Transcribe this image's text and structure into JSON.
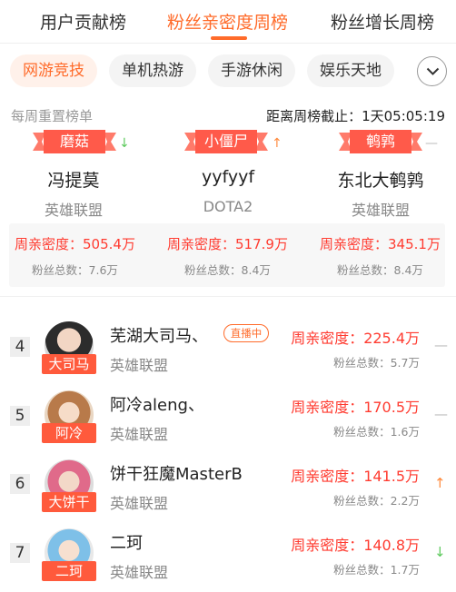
{
  "tabs": [
    {
      "label": "用户贡献榜"
    },
    {
      "label": "粉丝亲密度周榜"
    },
    {
      "label": "粉丝增长周榜"
    }
  ],
  "categories": [
    {
      "label": "网游竞技"
    },
    {
      "label": "单机热游"
    },
    {
      "label": "手游休闲"
    },
    {
      "label": "娱乐天地"
    }
  ],
  "meta": {
    "reset_note": "每周重置榜单",
    "countdown": "距离周榜截止：1天05:05:19"
  },
  "top3": [
    {
      "badge": "磨菇",
      "name": "冯提莫",
      "game": "英雄联盟",
      "score": "周亲密度：505.4万",
      "fans": "粉丝总数：7.6万",
      "trend": "down",
      "trend_icon": "arrow-down-icon"
    },
    {
      "badge": "小僵尸",
      "name": "yyfyyf",
      "game": "DOTA2",
      "score": "周亲密度：517.9万",
      "fans": "粉丝总数：8.4万",
      "trend": "up",
      "trend_icon": "arrow-up-icon"
    },
    {
      "badge": "鹌鹑",
      "name": "东北大鹌鹑",
      "game": "英雄联盟",
      "score": "周亲密度：345.1万",
      "fans": "粉丝总数：8.4万",
      "trend": "flat",
      "trend_icon": "dash-icon"
    }
  ],
  "list": [
    {
      "rank": "4",
      "name": "芜湖大司马、",
      "tag": "大司马",
      "game": "英雄联盟",
      "live": "直播中",
      "score": "周亲密度：225.4万",
      "fans": "粉丝总数：5.7万",
      "trend": "flat"
    },
    {
      "rank": "5",
      "name": "阿冷aleng、",
      "tag": "阿冷",
      "game": "英雄联盟",
      "score": "周亲密度：170.5万",
      "fans": "粉丝总数：1.6万",
      "trend": "flat"
    },
    {
      "rank": "6",
      "name": "饼干狂魔MasterB",
      "tag": "大饼干",
      "game": "英雄联盟",
      "score": "周亲密度：141.5万",
      "fans": "粉丝总数：2.2万",
      "trend": "up"
    },
    {
      "rank": "7",
      "name": "二珂",
      "tag": "二珂",
      "game": "英雄联盟",
      "score": "周亲密度：140.8万",
      "fans": "粉丝总数：1.7万",
      "trend": "down"
    }
  ],
  "colors": {
    "accent": "#ff6b2a",
    "score": "#ff3b30",
    "ribbon": "#ff5a4a",
    "trend_up": "#ff8a3d",
    "trend_down": "#5cc95c"
  }
}
